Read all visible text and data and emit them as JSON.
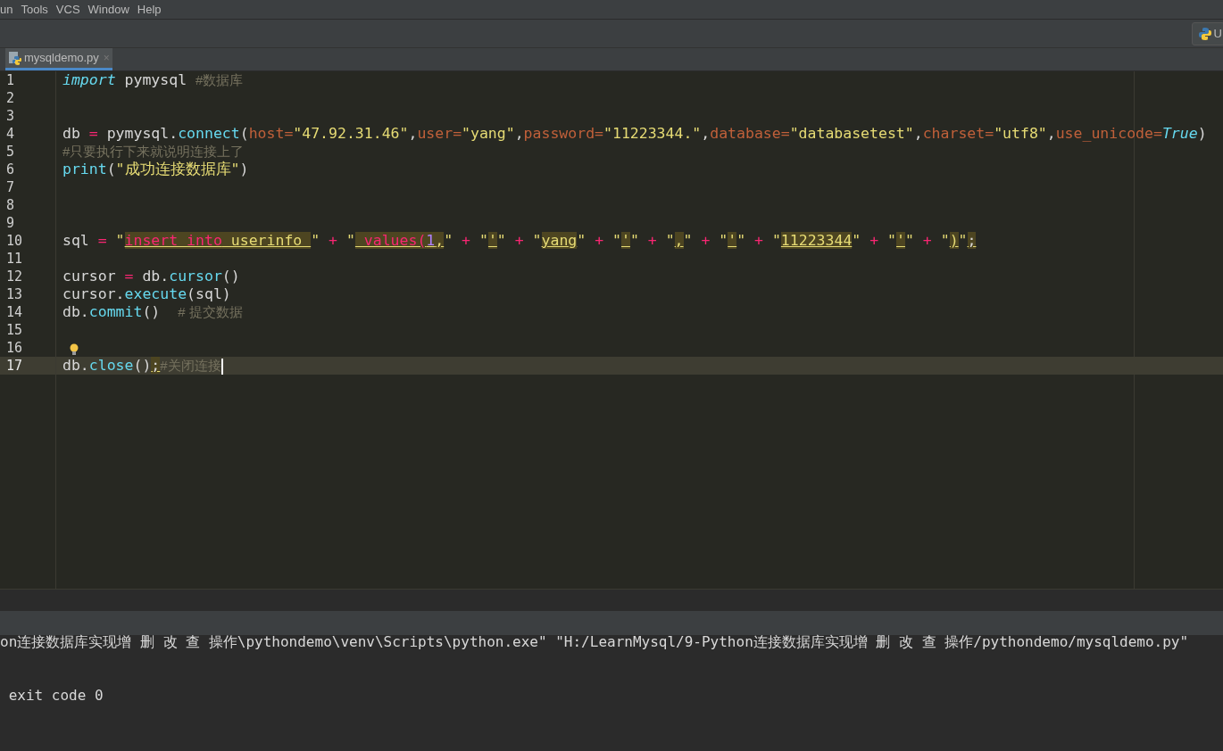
{
  "menu_bar": [
    {
      "label": "un"
    },
    {
      "label": "Tools"
    },
    {
      "label": "VCS"
    },
    {
      "label": "Window"
    },
    {
      "label": "Help"
    }
  ],
  "toolbar": {
    "run_config_button": {
      "label": "U"
    }
  },
  "tabs": [
    {
      "label": "mysqldemo.py",
      "selected": true,
      "close": "×"
    }
  ],
  "editor": {
    "lines": [
      {
        "number": "1",
        "tokens": [
          {
            "kind": "kw",
            "text": "import"
          },
          {
            "kind": "id",
            "text": " pymysql "
          },
          {
            "kind": "cmt",
            "text": "#数据库"
          }
        ]
      },
      {
        "number": "2"
      },
      {
        "number": "3"
      },
      {
        "number": "4",
        "tokens": [
          {
            "kind": "id",
            "text": "db "
          },
          {
            "kind": "op",
            "text": "="
          },
          {
            "kind": "id",
            "text": " pymysql."
          },
          {
            "kind": "fn",
            "text": "connect"
          },
          {
            "kind": "id",
            "text": "("
          },
          {
            "kind": "param",
            "text": "host="
          },
          {
            "kind": "str",
            "text": "\"47.92.31.46\""
          },
          {
            "kind": "id",
            "text": ","
          },
          {
            "kind": "param",
            "text": "user="
          },
          {
            "kind": "str",
            "text": "\"yang\""
          },
          {
            "kind": "id",
            "text": ","
          },
          {
            "kind": "param",
            "text": "password="
          },
          {
            "kind": "str",
            "text": "\"11223344.\""
          },
          {
            "kind": "id",
            "text": ","
          },
          {
            "kind": "param",
            "text": "database="
          },
          {
            "kind": "str",
            "text": "\"databasetest\""
          },
          {
            "kind": "id",
            "text": ","
          },
          {
            "kind": "param",
            "text": "charset="
          },
          {
            "kind": "str",
            "text": "\"utf8\""
          },
          {
            "kind": "id",
            "text": ","
          },
          {
            "kind": "param",
            "text": "use_unicode="
          },
          {
            "kind": "const",
            "text": "True"
          },
          {
            "kind": "id",
            "text": ")"
          }
        ]
      },
      {
        "number": "5",
        "tokens": [
          {
            "kind": "cmt",
            "text": "#只要执行下来就说明连接上了"
          }
        ]
      },
      {
        "number": "6",
        "tokens": [
          {
            "kind": "fn",
            "text": "print"
          },
          {
            "kind": "id",
            "text": "("
          },
          {
            "kind": "str",
            "text": "\"成功连接数据库\""
          },
          {
            "kind": "id",
            "text": ")"
          }
        ]
      },
      {
        "number": "7"
      },
      {
        "number": "8"
      },
      {
        "number": "9"
      },
      {
        "number": "10",
        "tokens": [
          {
            "kind": "id",
            "text": "sql "
          },
          {
            "kind": "op",
            "text": "="
          },
          {
            "kind": "str",
            "text": " \""
          },
          {
            "kind": "sqlkw",
            "text": "insert into",
            "hl": true
          },
          {
            "kind": "str",
            "text": " userinfo ",
            "hl": true
          },
          {
            "kind": "str",
            "text": "\""
          },
          {
            "kind": "op",
            "text": " + "
          },
          {
            "kind": "str",
            "text": "\""
          },
          {
            "kind": "sqlkw",
            "text": " values(",
            "hl": true
          },
          {
            "kind": "num",
            "text": "1",
            "hl": true
          },
          {
            "kind": "str",
            "text": ",",
            "hl": true
          },
          {
            "kind": "str",
            "text": "\""
          },
          {
            "kind": "op",
            "text": " + "
          },
          {
            "kind": "str",
            "text": "\""
          },
          {
            "kind": "str",
            "text": "'",
            "hl": true
          },
          {
            "kind": "str",
            "text": "\""
          },
          {
            "kind": "op",
            "text": " + "
          },
          {
            "kind": "str",
            "text": "\""
          },
          {
            "kind": "str",
            "text": "yang",
            "hl": true
          },
          {
            "kind": "str",
            "text": "\""
          },
          {
            "kind": "op",
            "text": " + "
          },
          {
            "kind": "str",
            "text": "\""
          },
          {
            "kind": "str",
            "text": "'",
            "hl": true
          },
          {
            "kind": "str",
            "text": "\""
          },
          {
            "kind": "op",
            "text": " + "
          },
          {
            "kind": "str",
            "text": "\""
          },
          {
            "kind": "str",
            "text": ",",
            "hl": true
          },
          {
            "kind": "str",
            "text": "\""
          },
          {
            "kind": "op",
            "text": " + "
          },
          {
            "kind": "str",
            "text": "\""
          },
          {
            "kind": "str",
            "text": "'",
            "hl": true
          },
          {
            "kind": "str",
            "text": "\""
          },
          {
            "kind": "op",
            "text": " + "
          },
          {
            "kind": "str",
            "text": "\""
          },
          {
            "kind": "str",
            "text": "11223344",
            "hl": true
          },
          {
            "kind": "str",
            "text": "\""
          },
          {
            "kind": "op",
            "text": " + "
          },
          {
            "kind": "str",
            "text": "\""
          },
          {
            "kind": "str",
            "text": "'",
            "hl": true
          },
          {
            "kind": "str",
            "text": "\""
          },
          {
            "kind": "op",
            "text": " + "
          },
          {
            "kind": "str",
            "text": "\""
          },
          {
            "kind": "str",
            "text": ")",
            "hl": true
          },
          {
            "kind": "str",
            "text": "\""
          },
          {
            "kind": "id",
            "text": ";",
            "hl": true
          }
        ]
      },
      {
        "number": "11"
      },
      {
        "number": "12",
        "tokens": [
          {
            "kind": "id",
            "text": "cursor "
          },
          {
            "kind": "op",
            "text": "="
          },
          {
            "kind": "id",
            "text": " db."
          },
          {
            "kind": "fn",
            "text": "cursor"
          },
          {
            "kind": "id",
            "text": "()"
          }
        ]
      },
      {
        "number": "13",
        "tokens": [
          {
            "kind": "id",
            "text": "cursor."
          },
          {
            "kind": "fn",
            "text": "execute"
          },
          {
            "kind": "id",
            "text": "(sql)"
          }
        ]
      },
      {
        "number": "14",
        "tokens": [
          {
            "kind": "id",
            "text": "db."
          },
          {
            "kind": "fn",
            "text": "commit"
          },
          {
            "kind": "id",
            "text": "()  "
          },
          {
            "kind": "cmt",
            "text": "# 提交数据"
          }
        ]
      },
      {
        "number": "15"
      },
      {
        "number": "16",
        "bulb": true
      },
      {
        "number": "17",
        "current": true,
        "tokens": [
          {
            "kind": "id",
            "text": "db."
          },
          {
            "kind": "fn",
            "text": "close"
          },
          {
            "kind": "id",
            "text": "()"
          },
          {
            "kind": "id",
            "text": ";",
            "hl": true
          },
          {
            "kind": "cmt",
            "text": "#关闭连接"
          }
        ]
      }
    ]
  },
  "console": {
    "lines": [
      "on连接数据库实现增 删 改 查 操作\\pythondemo\\venv\\Scripts\\python.exe\" \"H:/LearnMysql/9-Python连接数据库实现增 删 改 查 操作/pythondemo/mysqldemo.py\"",
      " exit code 0"
    ]
  }
}
